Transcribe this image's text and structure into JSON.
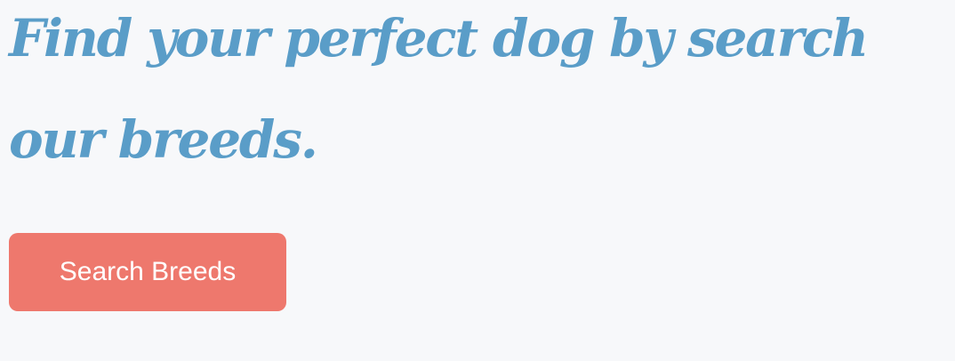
{
  "hero": {
    "heading": "Find your perfect dog by search our breeds.",
    "button_label": "Search Breeds"
  },
  "colors": {
    "background": "#f7f8fa",
    "heading": "#5a9dc8",
    "button": "#ee786d",
    "button_text": "#ffffff"
  }
}
